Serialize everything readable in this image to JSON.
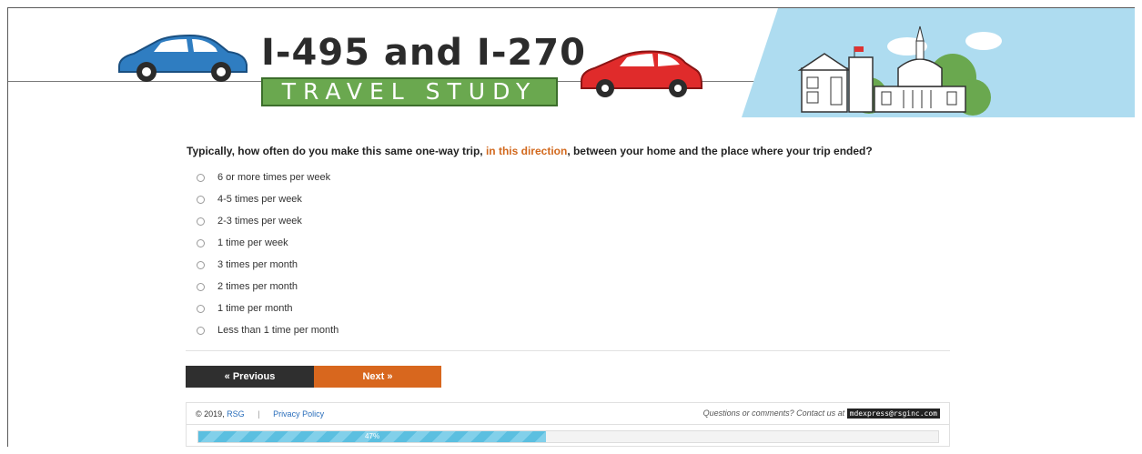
{
  "header": {
    "title": "I-495 and I-270",
    "subtitle": "TRAVEL STUDY"
  },
  "question": {
    "text_before": "Typically, how often do you make this same one-way trip, ",
    "highlight": "in this direction",
    "text_after": ", between your home and the place where your trip ended?",
    "highlight_color": "#d2691e"
  },
  "options": [
    "6 or more times per week",
    "4-5 times per week",
    "2-3 times per week",
    "1 time per week",
    "3 times per month",
    "2 times per month",
    "1 time per month",
    "Less than 1 time per month"
  ],
  "nav": {
    "previous_label": "« Previous",
    "next_label": "Next »",
    "previous_color": "#2f2f2f",
    "next_color": "#d8671e"
  },
  "footer": {
    "copyright": "© 2019,",
    "org_link": "RSG",
    "privacy_link": "Privacy Policy",
    "contact_text": "Questions or comments? Contact us at",
    "email": "mdexpress@rsginc.com"
  },
  "progress": {
    "percent": 47,
    "label": "47%"
  },
  "icons": {
    "blue_car": "car-icon",
    "red_car": "car-icon",
    "capitol": "capitol-building-icon"
  }
}
